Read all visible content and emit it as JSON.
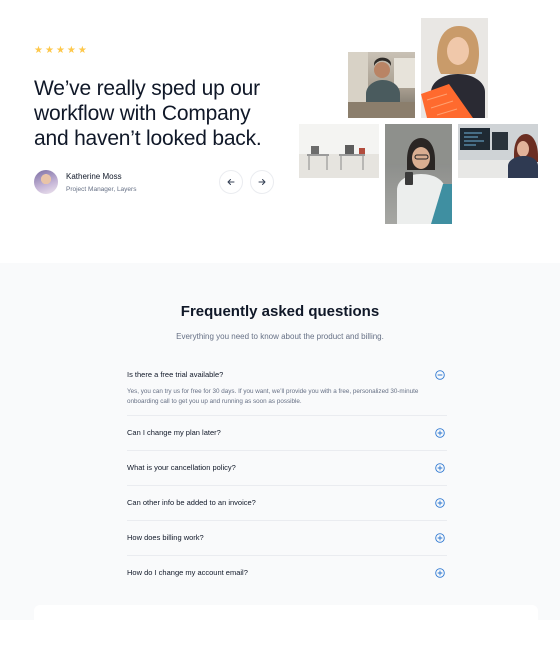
{
  "testimonial": {
    "rating": 5,
    "stars": [
      "★",
      "★",
      "★",
      "★",
      "★"
    ],
    "quote": "We’ve really sped up our workflow with Company and haven’t looked back.",
    "author_name": "Katherine Moss",
    "author_role": "Project Manager, Layers",
    "prev_icon": "arrow-left-icon",
    "next_icon": "arrow-right-icon"
  },
  "faq": {
    "title": "Frequently asked questions",
    "subtitle": "Everything you need to know about the product and billing.",
    "items": [
      {
        "question": "Is there a free trial available?",
        "answer": "Yes, you can try us for free for 30 days. If you want, we’ll provide you with a free, personalized 30-minute onboarding call to get you up and running as soon as possible.",
        "expanded": true,
        "icon": "minus-circle-icon"
      },
      {
        "question": "Can I change my plan later?",
        "answer": "",
        "expanded": false,
        "icon": "plus-circle-icon"
      },
      {
        "question": "What is your cancellation policy?",
        "answer": "",
        "expanded": false,
        "icon": "plus-circle-icon"
      },
      {
        "question": "Can other info be added to an invoice?",
        "answer": "",
        "expanded": false,
        "icon": "plus-circle-icon"
      },
      {
        "question": "How does billing work?",
        "answer": "",
        "expanded": false,
        "icon": "plus-circle-icon"
      },
      {
        "question": "How do I change my account email?",
        "answer": "",
        "expanded": false,
        "icon": "plus-circle-icon"
      }
    ]
  },
  "colors": {
    "star": "#fec84b",
    "accent": "#2e78d2",
    "text": "#101828",
    "muted": "#667085",
    "faq_bg": "#f9fafb"
  }
}
